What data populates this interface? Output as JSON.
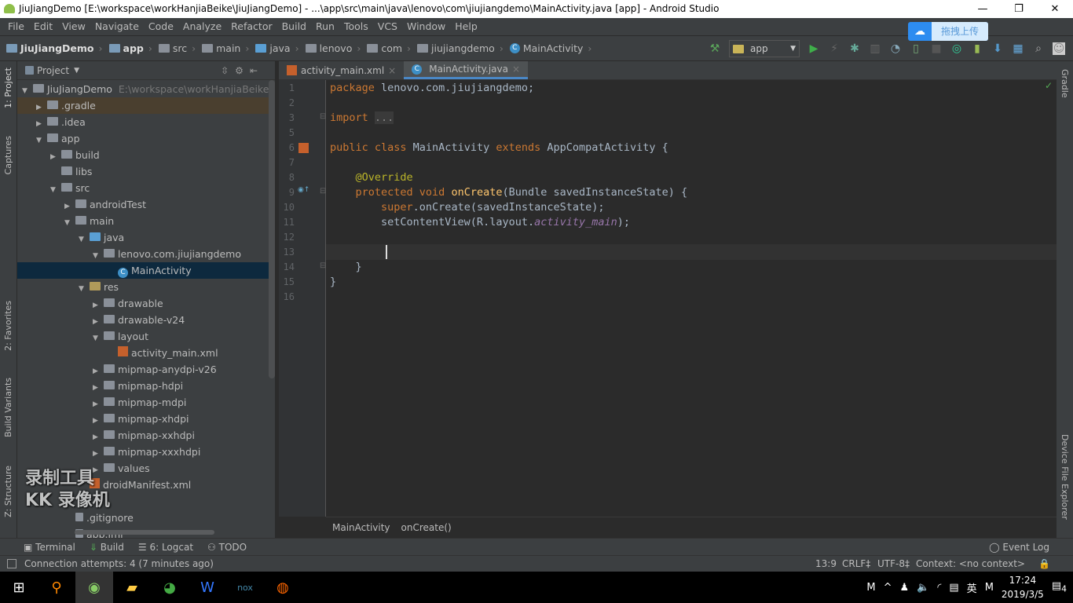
{
  "window": {
    "title": "JiuJiangDemo [E:\\workspace\\workHanjiaBeike\\JiuJiangDemo] - ...\\app\\src\\main\\java\\lenovo\\com\\jiujiangdemo\\MainActivity.java [app] - Android Studio",
    "minimize": "—",
    "maximize": "❐",
    "close": "✕"
  },
  "menu": [
    "File",
    "Edit",
    "View",
    "Navigate",
    "Code",
    "Analyze",
    "Refactor",
    "Build",
    "Run",
    "Tools",
    "VCS",
    "Window",
    "Help"
  ],
  "breadcrumb": [
    "JiuJiangDemo",
    "app",
    "src",
    "main",
    "java",
    "lenovo",
    "com",
    "jiujiangdemo",
    "MainActivity"
  ],
  "toolbar": {
    "run_config": "app",
    "upload_label": "拖拽上传"
  },
  "left_strip": {
    "project": "1: Project",
    "captures": "Captures",
    "favorites": "2: Favorites",
    "build_variants": "Build Variants",
    "structure": "Z: Structure"
  },
  "right_strip": {
    "gradle": "Gradle",
    "device_file_explorer": "Device File Explorer"
  },
  "project_panel": {
    "title": "Project",
    "tree": [
      {
        "label": "JiuJiangDemo",
        "hint": "E:\\workspace\\workHanjiaBeike\\Jiu",
        "level": 0,
        "arrow": "▼",
        "icon": "folder"
      },
      {
        "label": ".gradle",
        "level": 1,
        "arrow": "▶",
        "icon": "folder",
        "hl": true
      },
      {
        "label": ".idea",
        "level": 1,
        "arrow": "▶",
        "icon": "folder"
      },
      {
        "label": "app",
        "level": 1,
        "arrow": "▼",
        "icon": "folder"
      },
      {
        "label": "build",
        "level": 2,
        "arrow": "▶",
        "icon": "folder"
      },
      {
        "label": "libs",
        "level": 2,
        "arrow": "",
        "icon": "folder"
      },
      {
        "label": "src",
        "level": 2,
        "arrow": "▼",
        "icon": "folder"
      },
      {
        "label": "androidTest",
        "level": 3,
        "arrow": "▶",
        "icon": "folder"
      },
      {
        "label": "main",
        "level": 3,
        "arrow": "▼",
        "icon": "folder"
      },
      {
        "label": "java",
        "level": 4,
        "arrow": "▼",
        "icon": "folder"
      },
      {
        "label": "lenovo.com.jiujiangdemo",
        "level": 5,
        "arrow": "▼",
        "icon": "folder"
      },
      {
        "label": "MainActivity",
        "level": 6,
        "arrow": "",
        "icon": "class",
        "sel": true
      },
      {
        "label": "res",
        "level": 4,
        "arrow": "▼",
        "icon": "folder"
      },
      {
        "label": "drawable",
        "level": 5,
        "arrow": "▶",
        "icon": "folder"
      },
      {
        "label": "drawable-v24",
        "level": 5,
        "arrow": "▶",
        "icon": "folder"
      },
      {
        "label": "layout",
        "level": 5,
        "arrow": "▼",
        "icon": "folder"
      },
      {
        "label": "activity_main.xml",
        "level": 6,
        "arrow": "",
        "icon": "xml"
      },
      {
        "label": "mipmap-anydpi-v26",
        "level": 5,
        "arrow": "▶",
        "icon": "folder"
      },
      {
        "label": "mipmap-hdpi",
        "level": 5,
        "arrow": "▶",
        "icon": "folder"
      },
      {
        "label": "mipmap-mdpi",
        "level": 5,
        "arrow": "▶",
        "icon": "folder"
      },
      {
        "label": "mipmap-xhdpi",
        "level": 5,
        "arrow": "▶",
        "icon": "folder"
      },
      {
        "label": "mipmap-xxhdpi",
        "level": 5,
        "arrow": "▶",
        "icon": "folder"
      },
      {
        "label": "mipmap-xxxhdpi",
        "level": 5,
        "arrow": "▶",
        "icon": "folder"
      },
      {
        "label": "values",
        "level": 5,
        "arrow": "▶",
        "icon": "folder"
      },
      {
        "label": "droidManifest.xml",
        "level": 4,
        "arrow": "",
        "icon": "xml"
      },
      {
        "label": "",
        "level": 3,
        "arrow": "",
        "icon": ""
      },
      {
        "label": ".gitignore",
        "level": 3,
        "arrow": "",
        "icon": "file"
      },
      {
        "label": "app.iml",
        "level": 3,
        "arrow": "",
        "icon": "file"
      }
    ]
  },
  "watermark": "录制工具\nKK 录像机",
  "tabs": [
    {
      "label": "activity_main.xml",
      "icon": "xml",
      "active": false
    },
    {
      "label": "MainActivity.java",
      "icon": "class",
      "active": true
    }
  ],
  "editor": {
    "line_numbers": [
      "1",
      "2",
      "3",
      "5",
      "6",
      "7",
      "8",
      "9",
      "10",
      "11",
      "12",
      "13",
      "14",
      "15",
      "16"
    ],
    "lines": [
      [
        [
          "kw",
          "package "
        ],
        [
          "",
          "lenovo.com.jiujiangdemo;"
        ]
      ],
      [],
      [
        [
          "kw",
          "import "
        ],
        [
          "fd",
          "..."
        ]
      ],
      [],
      [
        [
          "kw",
          "public class "
        ],
        [
          "",
          "MainActivity "
        ],
        [
          "kw",
          "extends "
        ],
        [
          "",
          "AppCompatActivity {"
        ]
      ],
      [],
      [
        [
          "an",
          "    @Override"
        ]
      ],
      [
        [
          "kw",
          "    protected void "
        ],
        [
          "fn",
          "onCreate"
        ],
        [
          "",
          "(Bundle savedInstanceState) {"
        ]
      ],
      [
        [
          "kw",
          "        super"
        ],
        [
          "",
          ".onCreate(savedInstanceState);"
        ]
      ],
      [
        [
          "",
          "        setContentView(R.layout."
        ],
        [
          "it",
          "activity_main"
        ],
        [
          "",
          ");"
        ]
      ],
      [],
      [],
      [
        [
          "",
          "    }"
        ]
      ],
      [
        [
          "",
          "}"
        ]
      ],
      []
    ],
    "cursor": {
      "line": 13,
      "column": 9
    }
  },
  "editor_breadcrumb": [
    "MainActivity",
    "onCreate()"
  ],
  "bottom_tools": [
    "Terminal",
    "Build",
    "6: Logcat",
    "TODO"
  ],
  "event_log": "Event Log",
  "status": {
    "message": "Connection attempts: 4 (7 minutes ago)",
    "position": "13:9",
    "line_sep": "CRLF‡",
    "encoding": "UTF-8‡",
    "context": "Context: <no context>"
  },
  "taskbar": {
    "ime": "英",
    "time": "17:24",
    "date": "2019/3/5",
    "notifications": "4",
    "m1": "M",
    "m2": "M"
  }
}
